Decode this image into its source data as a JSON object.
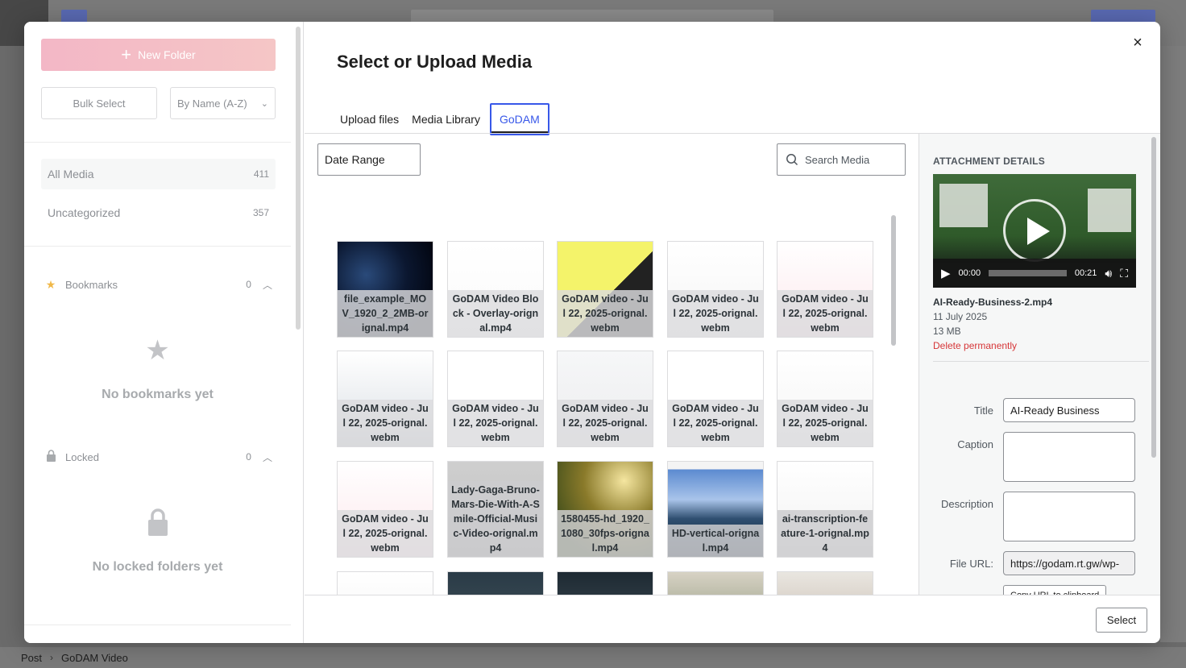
{
  "editor": {
    "breadcrumb": [
      "Post",
      "GoDAM Video"
    ]
  },
  "folders": {
    "new_folder_label": "New Folder",
    "bulk_select_label": "Bulk Select",
    "sort_label": "By Name (A-Z)",
    "items": [
      {
        "label": "All Media",
        "count": "411"
      },
      {
        "label": "Uncategorized",
        "count": "357"
      }
    ],
    "bookmarks": {
      "label": "Bookmarks",
      "count": "0",
      "empty": "No bookmarks yet"
    },
    "locked": {
      "label": "Locked",
      "count": "0",
      "empty": "No locked folders yet"
    }
  },
  "modal": {
    "title": "Select or Upload Media",
    "close_label": "×",
    "tabs": [
      {
        "label": "Upload files"
      },
      {
        "label": "Media Library"
      },
      {
        "label": "GoDAM"
      }
    ],
    "date_range_label": "Date Range",
    "search_placeholder": "Search Media",
    "select_label": "Select"
  },
  "media": [
    {
      "caption": "file_example_MOV_1920_2_2MB-orignal.mp4"
    },
    {
      "caption": "GoDAM Video Block - Overlay-orignal.mp4"
    },
    {
      "caption": "GoDAM video - Jul 22, 2025-orignal.webm"
    },
    {
      "caption": "GoDAM video - Jul 22, 2025-orignal.webm"
    },
    {
      "caption": "GoDAM video - Jul 22, 2025-orignal.webm"
    },
    {
      "caption": "GoDAM video - Jul 22, 2025-orignal.webm"
    },
    {
      "caption": "GoDAM video - Jul 22, 2025-orignal.webm"
    },
    {
      "caption": "GoDAM video - Jul 22, 2025-orignal.webm"
    },
    {
      "caption": "GoDAM video - Jul 22, 2025-orignal.webm"
    },
    {
      "caption": "GoDAM video - Jul 22, 2025-orignal.webm"
    },
    {
      "caption": "GoDAM video - Jul 22, 2025-orignal.webm"
    },
    {
      "caption": "Lady-Gaga-Bruno-Mars-Die-With-A-Smile-Official-Music-Video-orignal.mp4"
    },
    {
      "caption": "1580455-hd_1920_1080_30fps-orignal.mp4"
    },
    {
      "caption": "HD-vertical-orignal.mp4"
    },
    {
      "caption": "ai-transcription-feature-1-orignal.mp4"
    },
    {
      "caption": ""
    },
    {
      "caption": ""
    },
    {
      "caption": ""
    },
    {
      "caption": ""
    },
    {
      "caption": ""
    }
  ],
  "details": {
    "heading": "ATTACHMENT DETAILS",
    "video": {
      "current": "00:00",
      "duration": "00:21"
    },
    "filename": "AI-Ready-Business-2.mp4",
    "date": "11 July 2025",
    "size": "13 MB",
    "delete_label": "Delete permanently",
    "title_label": "Title",
    "title_value": "AI-Ready Business",
    "caption_label": "Caption",
    "caption_value": "",
    "description_label": "Description",
    "description_value": "",
    "url_label": "File URL:",
    "url_value": "https://godam.rt.gw/wp-",
    "copy_label": "Copy URL to clipboard"
  },
  "colors": {
    "accent": "#3858e9",
    "danger": "#d63638",
    "new_folder": "#f3b7c6"
  }
}
